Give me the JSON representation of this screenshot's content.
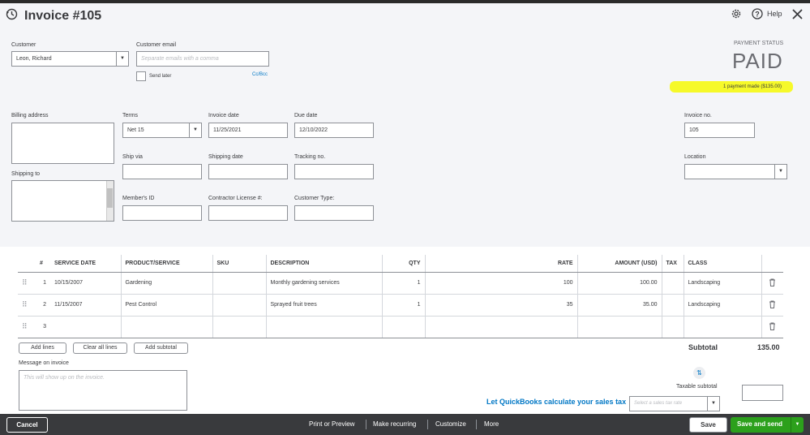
{
  "header": {
    "title": "Invoice #105",
    "help_label": "Help"
  },
  "customer": {
    "label": "Customer",
    "value": "Leon, Richard",
    "email_label": "Customer email",
    "email_placeholder": "Separate emails with a comma",
    "send_later_label": "Send later",
    "ccbcc_label": "Cc/Bcc"
  },
  "payment": {
    "status_label": "PAYMENT STATUS",
    "status": "PAID",
    "payment_made": "1 payment made ($135.00)",
    "highlight_color": "#f6f92a"
  },
  "billing": {
    "billing_address_label": "Billing address",
    "shipping_to_label": "Shipping to",
    "terms_label": "Terms",
    "terms_value": "Net 15",
    "invoice_date_label": "Invoice date",
    "invoice_date_value": "11/25/2021",
    "due_date_label": "Due date",
    "due_date_value": "12/10/2022",
    "invoice_no_label": "Invoice no.",
    "invoice_no_value": "105",
    "ship_via_label": "Ship via",
    "shipping_date_label": "Shipping date",
    "tracking_no_label": "Tracking no.",
    "location_label": "Location",
    "member_id_label": "Member's ID",
    "contractor_license_label": "Contractor License #:",
    "customer_type_label": "Customer Type:"
  },
  "table": {
    "headers": [
      "#",
      "SERVICE DATE",
      "PRODUCT/SERVICE",
      "SKU",
      "DESCRIPTION",
      "QTY",
      "RATE",
      "AMOUNT (USD)",
      "TAX",
      "CLASS"
    ],
    "rows": [
      {
        "num": "1",
        "service_date": "10/15/2007",
        "product": "Gardening",
        "sku": "",
        "description": "Monthly gardening services",
        "qty": "1",
        "rate": "100",
        "amount": "100.00",
        "tax": "",
        "class": "Landscaping"
      },
      {
        "num": "2",
        "service_date": "11/15/2007",
        "product": "Pest Control",
        "sku": "",
        "description": "Sprayed fruit trees",
        "qty": "1",
        "rate": "35",
        "amount": "35.00",
        "tax": "",
        "class": "Landscaping"
      },
      {
        "num": "3",
        "service_date": "",
        "product": "",
        "sku": "",
        "description": "",
        "qty": "",
        "rate": "",
        "amount": "",
        "tax": "",
        "class": ""
      }
    ]
  },
  "actions": {
    "add_lines": "Add lines",
    "clear_all_lines": "Clear all lines",
    "add_subtotal": "Add subtotal"
  },
  "totals": {
    "subtotal_label": "Subtotal",
    "subtotal_value": "135.00",
    "taxable_subtotal_label": "Taxable subtotal"
  },
  "message": {
    "label": "Message on invoice",
    "placeholder": "This will show up on the invoice."
  },
  "sales_tax": {
    "link": "Let QuickBooks calculate your sales tax",
    "rate_placeholder": "Select a sales tax rate"
  },
  "footer": {
    "cancel": "Cancel",
    "print_preview": "Print or Preview",
    "make_recurring": "Make recurring",
    "customize": "Customize",
    "more": "More",
    "save": "Save",
    "save_and_send": "Save and send",
    "accent_green": "#2ca01c"
  }
}
